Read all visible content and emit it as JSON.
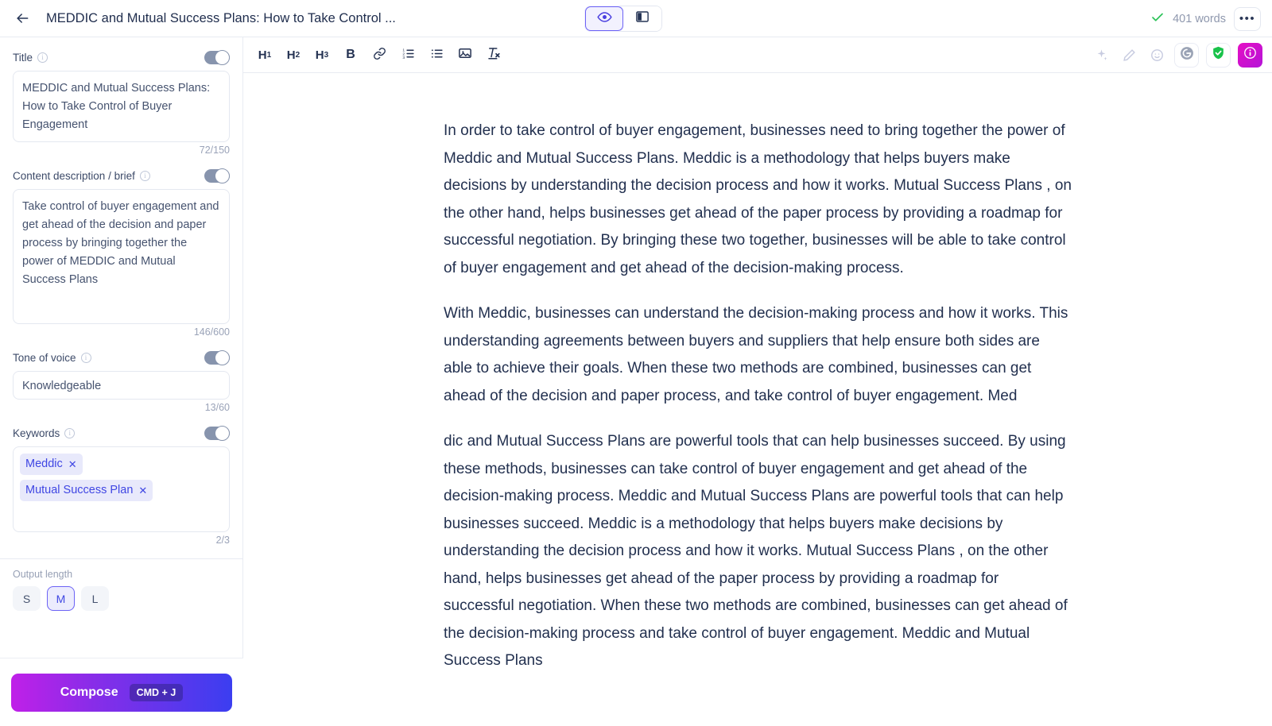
{
  "header": {
    "back_icon": "arrow-left-icon",
    "title": "MEDDIC and Mutual Success Plans: How to Take Control ...",
    "view_toggle": [
      {
        "name": "preview-view",
        "icon": "eye-icon",
        "active": true
      },
      {
        "name": "split-view",
        "icon": "panel-layout-icon",
        "active": false
      }
    ],
    "saved_icon": "check-icon",
    "word_count": "401 words",
    "more_label": "•••"
  },
  "sidebar": {
    "fields": [
      {
        "key": "title",
        "label": "Title",
        "info_icon": "info-icon",
        "toggle": "off",
        "value": "MEDDIC and Mutual Success Plans: How to Take Control of Buyer Engagement",
        "counter": "72/150"
      },
      {
        "key": "brief",
        "label": "Content description / brief",
        "info_icon": "info-icon",
        "toggle": "off",
        "value": "Take control of buyer engagement and get ahead of the decision and paper process by bringing together the power of MEDDIC and Mutual Success Plans",
        "counter": "146/600"
      },
      {
        "key": "tone",
        "label": "Tone of voice",
        "info_icon": "info-icon",
        "toggle": "off",
        "value": "Knowledgeable",
        "counter": "13/60"
      },
      {
        "key": "keywords",
        "label": "Keywords",
        "info_icon": "info-icon",
        "toggle": "off",
        "counter": "2/3"
      }
    ],
    "keywords": [
      {
        "label": "Meddic",
        "remove_icon": "close-icon"
      },
      {
        "label": "Mutual Success Plan",
        "remove_icon": "close-icon"
      }
    ],
    "output_length": {
      "label": "Output length",
      "options": [
        {
          "label": "S",
          "active": false
        },
        {
          "label": "M",
          "active": true
        },
        {
          "label": "L",
          "active": false
        }
      ]
    },
    "compose": {
      "label": "Compose",
      "shortcut": "CMD + J"
    }
  },
  "toolbar": {
    "left": [
      {
        "name": "heading-1-button",
        "label": "H",
        "sub": "1"
      },
      {
        "name": "heading-2-button",
        "label": "H",
        "sub": "2"
      },
      {
        "name": "heading-3-button",
        "label": "H",
        "sub": "3"
      },
      {
        "name": "bold-button",
        "label": "B",
        "sub": ""
      },
      {
        "name": "link-button",
        "label": "link-icon",
        "sub": ""
      },
      {
        "name": "ordered-list-button",
        "label": "ordered-list-icon",
        "sub": ""
      },
      {
        "name": "bullet-list-button",
        "label": "bullet-list-icon",
        "sub": ""
      },
      {
        "name": "image-button",
        "label": "image-icon",
        "sub": ""
      },
      {
        "name": "clear-format-button",
        "label": "clear-format-icon",
        "sub": ""
      }
    ],
    "right": [
      {
        "name": "ai-sparkle-icon"
      },
      {
        "name": "edit-pencil-icon"
      },
      {
        "name": "emoji-icon"
      },
      {
        "name": "grammarly-icon"
      },
      {
        "name": "shield-check-icon"
      },
      {
        "name": "info-badge-icon"
      }
    ]
  },
  "document": {
    "paragraphs": [
      "In order to take control of buyer engagement, businesses need to bring together the power of Meddic and Mutual Success Plans. Meddic is a methodology that helps buyers make decisions by understanding the decision process and how it works. Mutual Success Plans , on the other hand, helps businesses get ahead of the paper process by providing a roadmap for successful negotiation. By bringing these two together, businesses will be able to take control of buyer engagement and get ahead of the decision-making process.",
      "With Meddic, businesses can understand the decision-making process and how it works. This understanding agreements between buyers and suppliers that help ensure both sides are able to achieve their goals. When these two methods are combined, businesses can get ahead of the decision and paper process, and take control of buyer engagement. Med",
      "dic and Mutual Success Plans are powerful tools that can help businesses succeed. By using these methods, businesses can take control of buyer engagement and get ahead of the decision-making process. Meddic and Mutual Success Plans are powerful tools that can help businesses succeed. Meddic is a methodology that helps buyers make decisions by understanding the decision process and how it works. Mutual Success Plans , on the other hand, helps businesses get ahead of the paper process by providing a roadmap for successful negotiation. When these two methods are combined, businesses can get ahead of the decision-making process and take control of buyer engagement. Meddic and Mutual Success Plans"
    ]
  },
  "colors": {
    "accent_indigo": "#3f46e3",
    "toggle_grey": "#8794ad",
    "text_dark": "#22304f",
    "success_green": "#2ec35a",
    "magenta": "#e60ec4"
  }
}
